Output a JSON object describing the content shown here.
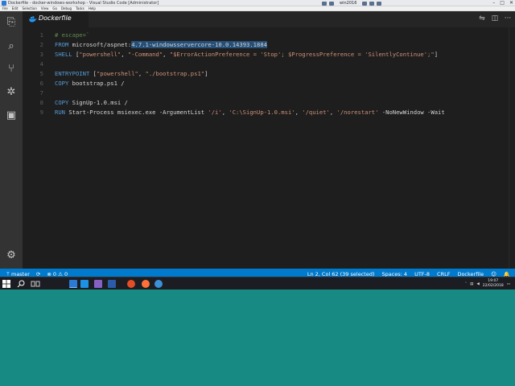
{
  "window": {
    "title": "Dockerfile - docker-windows-workshop - Visual Studio Code [Administrator]",
    "vm_name": "win2016",
    "controls": {
      "minimize": "–",
      "maximize": "□",
      "close": "✕"
    }
  },
  "menu": [
    "File",
    "Edit",
    "Selection",
    "View",
    "Go",
    "Debug",
    "Tasks",
    "Help"
  ],
  "activity_bar": [
    {
      "name": "explorer-icon",
      "glyph": "⎘"
    },
    {
      "name": "search-icon",
      "glyph": "⌕"
    },
    {
      "name": "source-control-icon",
      "glyph": "⑂"
    },
    {
      "name": "debug-icon",
      "glyph": "✲"
    },
    {
      "name": "extensions-icon",
      "glyph": "▣"
    },
    {
      "name": "settings-gear-icon",
      "glyph": "⚙"
    }
  ],
  "tab": {
    "label": "Dockerfile",
    "icon": "docker-whale-icon"
  },
  "editor_actions": [
    "⇋",
    "◫",
    "···"
  ],
  "editor": {
    "lines": [
      {
        "n": "1",
        "segments": [
          {
            "t": "# escape=`",
            "c": "cm"
          }
        ]
      },
      {
        "n": "2",
        "segments": [
          {
            "t": "FROM ",
            "c": "kw"
          },
          {
            "t": "microsoft/aspnet:",
            "c": ""
          },
          {
            "t": "4.7.1-windowsservercore-10.0.14393.1884",
            "c": "sel"
          }
        ]
      },
      {
        "n": "3",
        "segments": [
          {
            "t": "SHELL ",
            "c": "kw"
          },
          {
            "t": "[",
            "c": ""
          },
          {
            "t": "\"powershell\"",
            "c": "str"
          },
          {
            "t": ", ",
            "c": ""
          },
          {
            "t": "\"-Command\"",
            "c": "str"
          },
          {
            "t": ", ",
            "c": ""
          },
          {
            "t": "\"$ErrorActionPreference = 'Stop'; $ProgressPreference = 'SilentlyContinue';\"",
            "c": "str"
          },
          {
            "t": "]",
            "c": ""
          }
        ]
      },
      {
        "n": "4",
        "segments": []
      },
      {
        "n": "5",
        "segments": [
          {
            "t": "ENTRYPOINT ",
            "c": "kw"
          },
          {
            "t": "[",
            "c": ""
          },
          {
            "t": "\"powershell\"",
            "c": "str"
          },
          {
            "t": ", ",
            "c": ""
          },
          {
            "t": "\"./bootstrap.ps1\"",
            "c": "str"
          },
          {
            "t": "]",
            "c": ""
          }
        ]
      },
      {
        "n": "6",
        "segments": [
          {
            "t": "COPY ",
            "c": "kw"
          },
          {
            "t": "bootstrap.ps1 /",
            "c": ""
          }
        ]
      },
      {
        "n": "7",
        "segments": []
      },
      {
        "n": "8",
        "segments": [
          {
            "t": "COPY ",
            "c": "kw"
          },
          {
            "t": "SignUp-1.0.msi /",
            "c": ""
          }
        ]
      },
      {
        "n": "9",
        "segments": [
          {
            "t": "RUN ",
            "c": "kw"
          },
          {
            "t": "Start-Process msiexec.exe -ArgumentList ",
            "c": ""
          },
          {
            "t": "'/i'",
            "c": "str"
          },
          {
            "t": ", ",
            "c": ""
          },
          {
            "t": "'C:\\SignUp-1.0.msi'",
            "c": "str"
          },
          {
            "t": ", ",
            "c": ""
          },
          {
            "t": "'/quiet'",
            "c": "str"
          },
          {
            "t": ", ",
            "c": ""
          },
          {
            "t": "'/norestart'",
            "c": "str"
          },
          {
            "t": " -NoNewWindow -Wait",
            "c": ""
          }
        ]
      }
    ]
  },
  "status": {
    "branch": "master",
    "sync_glyph": "⟳",
    "errors_glyph": "⊗",
    "errors": "0",
    "warnings_glyph": "⚠",
    "warnings": "0",
    "position": "Ln 2, Col 62 (39 selected)",
    "spaces": "Spaces: 4",
    "encoding": "UTF-8",
    "eol": "CRLF",
    "language": "Dockerfile",
    "feedback_glyph": "☺",
    "bell_glyph": "🔔"
  },
  "taskbar": {
    "time": "19:07",
    "date": "22/02/2018",
    "colors": {
      "start": "#ffffff",
      "search": "#ffffff",
      "task_view": "#cccccc",
      "vscode": "#2c7ad6",
      "docker": "#1d91e6",
      "vs": "#8661c5",
      "powershell": "#2a5caa",
      "chrome": "#e44d26",
      "firefox": "#ff7139",
      "ie": "#3d8fd8"
    }
  }
}
